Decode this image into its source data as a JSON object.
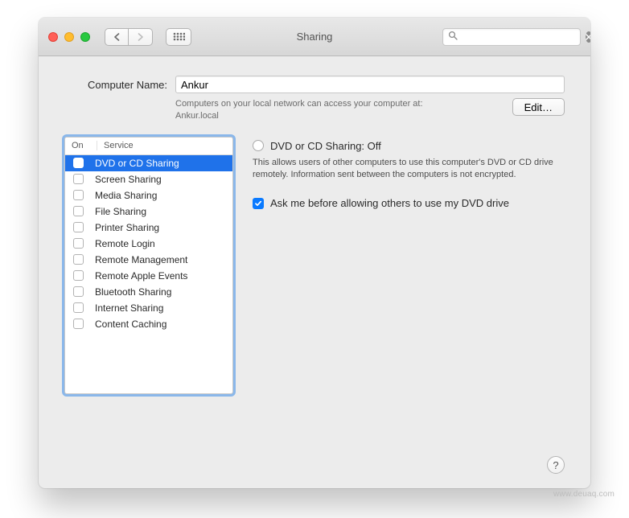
{
  "window": {
    "title": "Sharing"
  },
  "search": {
    "placeholder": ""
  },
  "form": {
    "computer_name_label": "Computer Name:",
    "computer_name_value": "Ankur",
    "access_note_line1": "Computers on your local network can access your computer at:",
    "access_note_line2": "Ankur.local",
    "edit_button": "Edit…"
  },
  "list": {
    "col_on": "On",
    "col_service": "Service",
    "items": [
      {
        "name": "DVD or CD Sharing",
        "on": false,
        "selected": true
      },
      {
        "name": "Screen Sharing",
        "on": false,
        "selected": false
      },
      {
        "name": "Media Sharing",
        "on": false,
        "selected": false
      },
      {
        "name": "File Sharing",
        "on": false,
        "selected": false
      },
      {
        "name": "Printer Sharing",
        "on": false,
        "selected": false
      },
      {
        "name": "Remote Login",
        "on": false,
        "selected": false
      },
      {
        "name": "Remote Management",
        "on": false,
        "selected": false
      },
      {
        "name": "Remote Apple Events",
        "on": false,
        "selected": false
      },
      {
        "name": "Bluetooth Sharing",
        "on": false,
        "selected": false
      },
      {
        "name": "Internet Sharing",
        "on": false,
        "selected": false
      },
      {
        "name": "Content Caching",
        "on": false,
        "selected": false
      }
    ]
  },
  "detail": {
    "heading": "DVD or CD Sharing: Off",
    "description": "This allows users of other computers to use this computer's DVD or CD drive remotely. Information sent between the computers is not encrypted.",
    "ask_checkbox_label": "Ask me before allowing others to use my DVD drive",
    "ask_checked": true
  },
  "help_tooltip": "?",
  "watermark": "www.deuaq.com"
}
